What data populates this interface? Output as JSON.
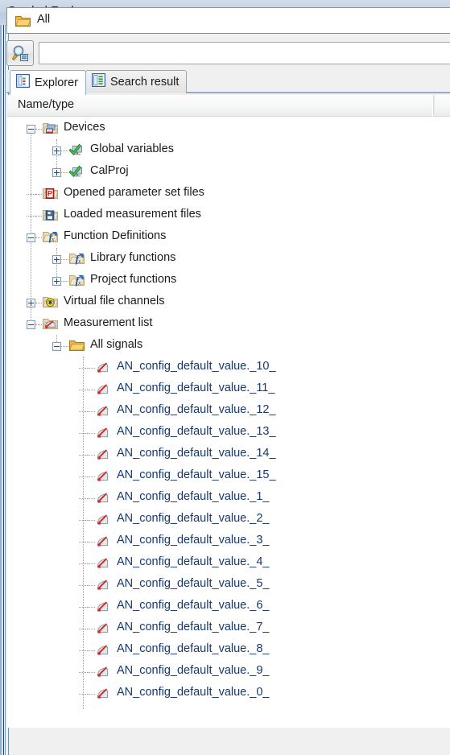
{
  "window": {
    "title": "Symbol Explorer"
  },
  "scope_bar": {
    "icon": "folder-icon",
    "label": "All"
  },
  "search": {
    "button_icon": "search-icon",
    "value": "",
    "placeholder": ""
  },
  "tabs": [
    {
      "label": "Explorer",
      "icon": "explorer-icon",
      "active": true
    },
    {
      "label": "Search result",
      "icon": "search-result-icon",
      "active": false
    }
  ],
  "tree_header": {
    "column_name": "Name/type"
  },
  "tree": [
    {
      "label": "Devices",
      "level": 0,
      "icon": "devices-folder-icon",
      "expander": "minus"
    },
    {
      "label": "Global variables",
      "level": 1,
      "icon": "green-check-monitor-icon",
      "expander": "plus"
    },
    {
      "label": "CalProj",
      "level": 1,
      "icon": "green-check-monitor-icon",
      "expander": "plus"
    },
    {
      "label": "Opened parameter set files",
      "level": 0,
      "icon": "parameter-set-folder-icon",
      "expander": "none"
    },
    {
      "label": "Loaded measurement files",
      "level": 0,
      "icon": "measurement-file-folder-icon",
      "expander": "none"
    },
    {
      "label": "Function Definitions",
      "level": 0,
      "icon": "function-folder-icon",
      "expander": "minus"
    },
    {
      "label": "Library functions",
      "level": 1,
      "icon": "function-folder-icon",
      "expander": "plus"
    },
    {
      "label": "Project functions",
      "level": 1,
      "icon": "function-folder-icon",
      "expander": "plus"
    },
    {
      "label": "Virtual file channels",
      "level": 0,
      "icon": "virtual-channel-folder-icon",
      "expander": "plus"
    },
    {
      "label": "Measurement list",
      "level": 0,
      "icon": "measurement-list-folder-icon",
      "expander": "minus"
    },
    {
      "label": "All signals",
      "level": 1,
      "icon": "folder-icon",
      "expander": "minus"
    },
    {
      "label": "AN_config_default_value._10_",
      "level": 2,
      "icon": "signal-gauge-icon",
      "expander": "none"
    },
    {
      "label": "AN_config_default_value._11_",
      "level": 2,
      "icon": "signal-gauge-icon",
      "expander": "none"
    },
    {
      "label": "AN_config_default_value._12_",
      "level": 2,
      "icon": "signal-gauge-icon",
      "expander": "none"
    },
    {
      "label": "AN_config_default_value._13_",
      "level": 2,
      "icon": "signal-gauge-icon",
      "expander": "none"
    },
    {
      "label": "AN_config_default_value._14_",
      "level": 2,
      "icon": "signal-gauge-icon",
      "expander": "none"
    },
    {
      "label": "AN_config_default_value._15_",
      "level": 2,
      "icon": "signal-gauge-icon",
      "expander": "none"
    },
    {
      "label": "AN_config_default_value._1_",
      "level": 2,
      "icon": "signal-gauge-icon",
      "expander": "none"
    },
    {
      "label": "AN_config_default_value._2_",
      "level": 2,
      "icon": "signal-gauge-icon",
      "expander": "none"
    },
    {
      "label": "AN_config_default_value._3_",
      "level": 2,
      "icon": "signal-gauge-icon",
      "expander": "none"
    },
    {
      "label": "AN_config_default_value._4_",
      "level": 2,
      "icon": "signal-gauge-icon",
      "expander": "none"
    },
    {
      "label": "AN_config_default_value._5_",
      "level": 2,
      "icon": "signal-gauge-icon",
      "expander": "none"
    },
    {
      "label": "AN_config_default_value._6_",
      "level": 2,
      "icon": "signal-gauge-icon",
      "expander": "none"
    },
    {
      "label": "AN_config_default_value._7_",
      "level": 2,
      "icon": "signal-gauge-icon",
      "expander": "none"
    },
    {
      "label": "AN_config_default_value._8_",
      "level": 2,
      "icon": "signal-gauge-icon",
      "expander": "none"
    },
    {
      "label": "AN_config_default_value._9_",
      "level": 2,
      "icon": "signal-gauge-icon",
      "expander": "none"
    },
    {
      "label": "AN_config_default_value._0_",
      "level": 2,
      "icon": "signal-gauge-icon",
      "expander": "none"
    }
  ],
  "colors": {
    "title_bar": "#c6d3e3",
    "signal_text": "#17386b",
    "tab_accent": "#8fadcb",
    "folder": "#f2c14e",
    "tree_text": "#1a1a1a"
  }
}
